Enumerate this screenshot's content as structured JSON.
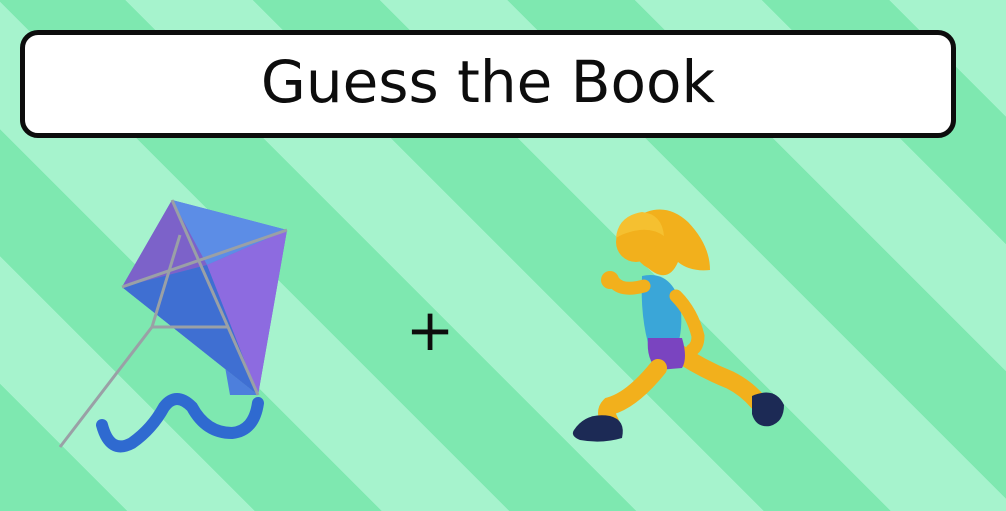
{
  "title": "Guess the Book",
  "operator": "+",
  "clues": [
    {
      "icon": "kite-icon"
    },
    {
      "icon": "woman-running-icon"
    }
  ],
  "colors": {
    "stripe_dark": "#7ee8b0",
    "stripe_light": "#a6f3cd",
    "title_bg": "#ffffff",
    "title_border": "#0d0d0d",
    "text": "#0d0d0d"
  }
}
